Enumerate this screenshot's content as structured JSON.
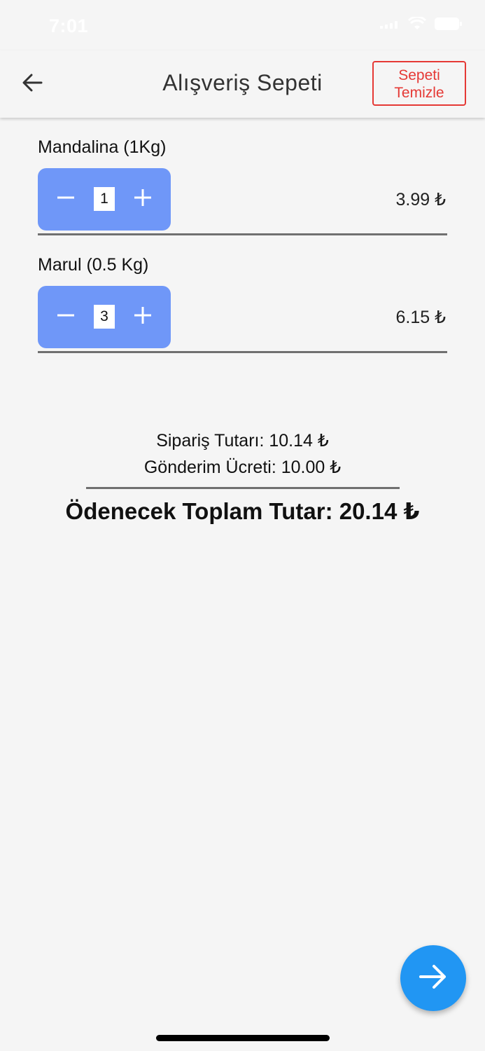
{
  "status_bar": {
    "time": "7:01"
  },
  "header": {
    "title": "Alışveriş Sepeti",
    "clear_button": {
      "line1": "Sepeti",
      "line2": "Temizle"
    },
    "back_icon": "arrow-left-icon"
  },
  "cart": {
    "items": [
      {
        "name": "Mandalina (1Kg)",
        "quantity": "1",
        "price": "3.99 ₺"
      },
      {
        "name": "Marul (0.5 Kg)",
        "quantity": "3",
        "price": "6.15 ₺"
      }
    ]
  },
  "summary": {
    "order_total": "Sipariş Tutarı: 10.14 ₺",
    "shipping_fee": "Gönderim Ücreti: 10.00 ₺",
    "grand_total": "Ödenecek Toplam Tutar: 20.14 ₺"
  },
  "fab": {
    "icon": "arrow-right-icon"
  },
  "colors": {
    "accent_blue": "#2196f3",
    "stepper_blue": "#6f97f8",
    "danger_red": "#e53935",
    "background": "#f5f5f5"
  }
}
